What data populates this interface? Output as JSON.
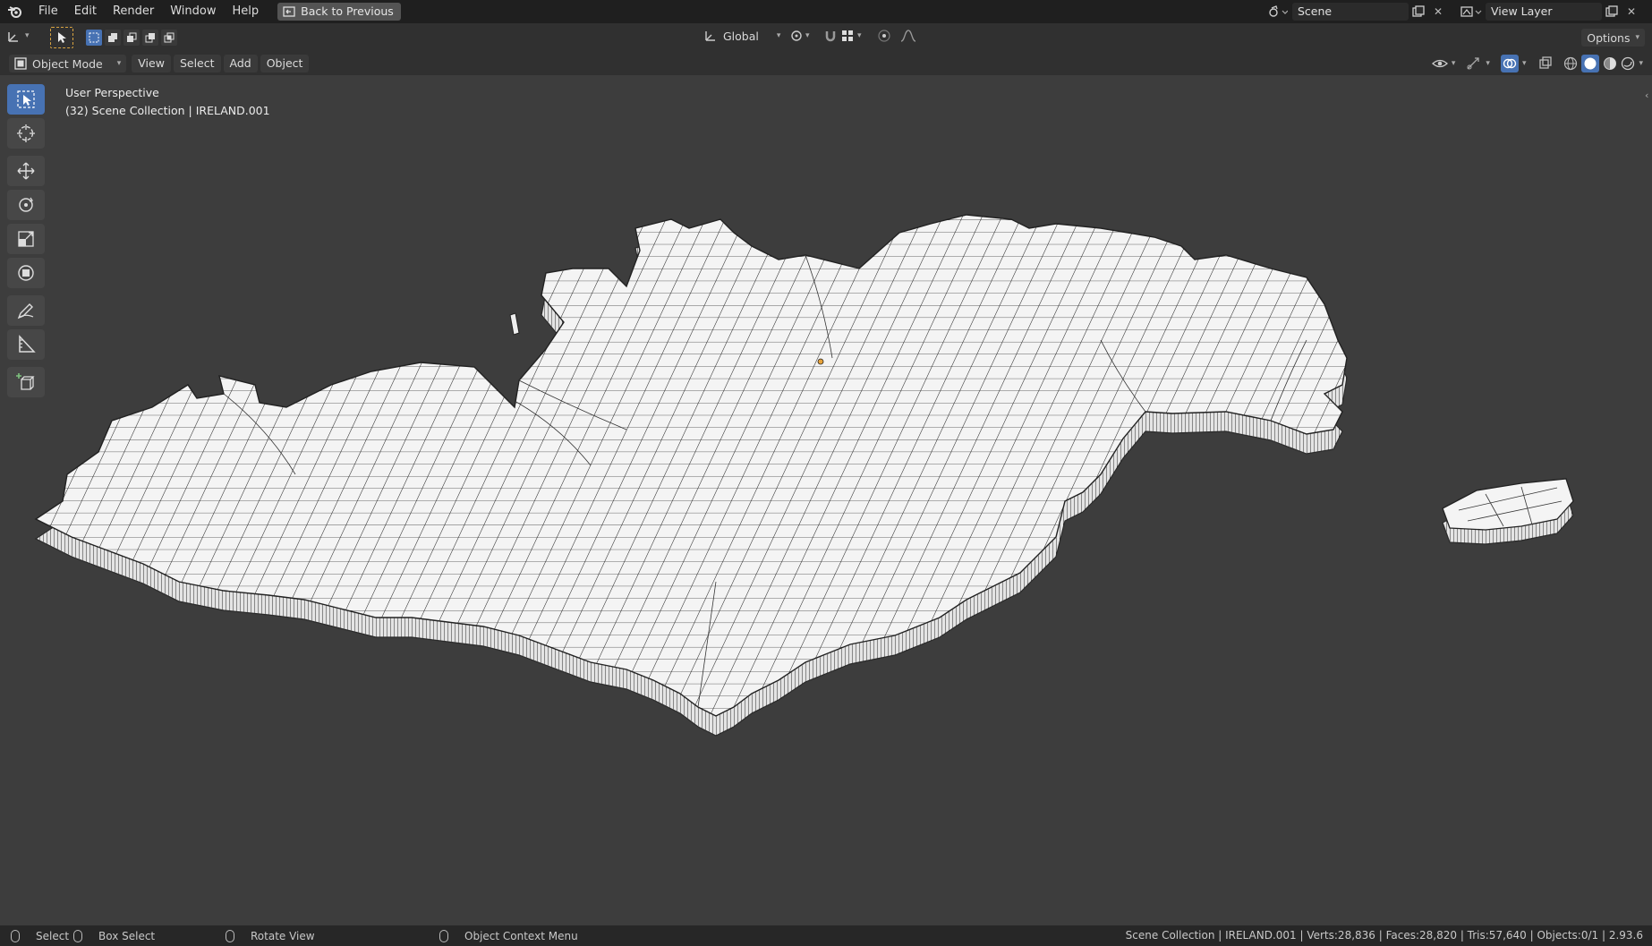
{
  "menu": {
    "items": [
      "File",
      "Edit",
      "Render",
      "Window",
      "Help"
    ],
    "back_label": "Back to Previous"
  },
  "scene": {
    "scene_name": "Scene",
    "view_layer": "View Layer"
  },
  "toolrow": {
    "transform_orientation": "Global",
    "options_label": "Options"
  },
  "header": {
    "mode": "Object Mode",
    "view": "View",
    "select": "Select",
    "add": "Add",
    "object": "Object"
  },
  "viewport": {
    "perspective": "User Perspective",
    "collection_info": "(32) Scene Collection | IRELAND.001"
  },
  "status": {
    "select": "Select",
    "box_select": "Box Select",
    "rotate_view": "Rotate View",
    "context_menu": "Object Context Menu",
    "stats": "Scene Collection | IRELAND.001 | Verts:28,836 | Faces:28,820 | Tris:57,640 | Objects:0/1 | 2.93.6"
  },
  "colors": {
    "active_tool": "#4772b3",
    "mesh_fill": "#f2f2f2",
    "wire": "#1a1a1a",
    "origin": "#e8a33a"
  }
}
